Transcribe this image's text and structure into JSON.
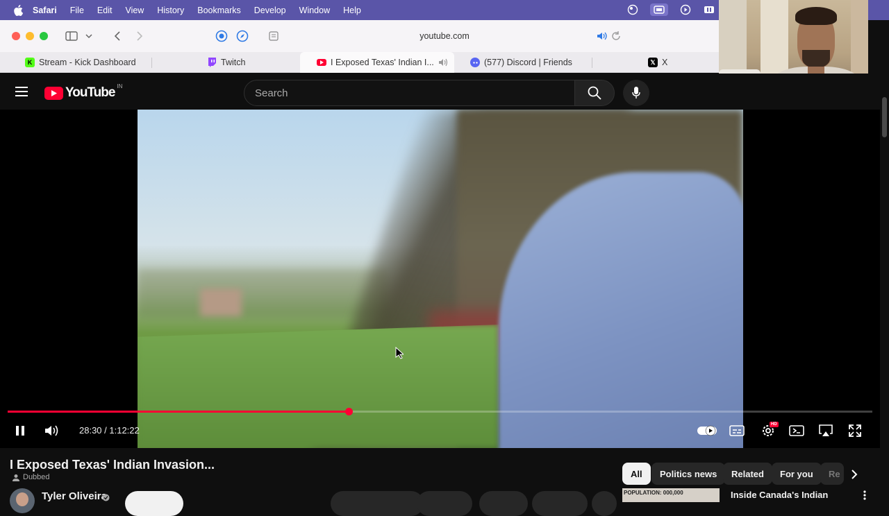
{
  "menubar": {
    "app": "Safari",
    "items": [
      "File",
      "Edit",
      "View",
      "History",
      "Bookmarks",
      "Develop",
      "Window",
      "Help"
    ]
  },
  "toolbar": {
    "url": "youtube.com"
  },
  "tabs": [
    {
      "label": "Stream - Kick Dashboard",
      "favicon": "K",
      "color": "#53fc18"
    },
    {
      "label": "Twitch",
      "favicon": "twitch",
      "color": "#9146ff"
    },
    {
      "label": "I Exposed Texas' Indian I...",
      "favicon": "youtube",
      "color": "#ff0033",
      "active": true,
      "audio": true
    },
    {
      "label": "(577) Discord | Friends",
      "favicon": "discord",
      "color": "#5865f2"
    },
    {
      "label": "X",
      "favicon": "X",
      "color": "#000000"
    }
  ],
  "youtube": {
    "logo_text": "YouTube",
    "region": "IN",
    "search_placeholder": "Search"
  },
  "player": {
    "current_time": "28:30",
    "duration": "1:12:22",
    "time_display": "28:30 / 1:12:22",
    "progress_fraction": 0.394,
    "settings_badge": "HD"
  },
  "video": {
    "title": "I Exposed Texas' Indian Invasion...",
    "dubbed_label": "Dubbed",
    "channel": "Tyler Oliveira"
  },
  "chips": [
    "All",
    "Politics news",
    "Related",
    "For you",
    "Re"
  ],
  "related": {
    "thumb_text": "POPULATION: 000,000",
    "title": "Inside Canada's Indian"
  }
}
